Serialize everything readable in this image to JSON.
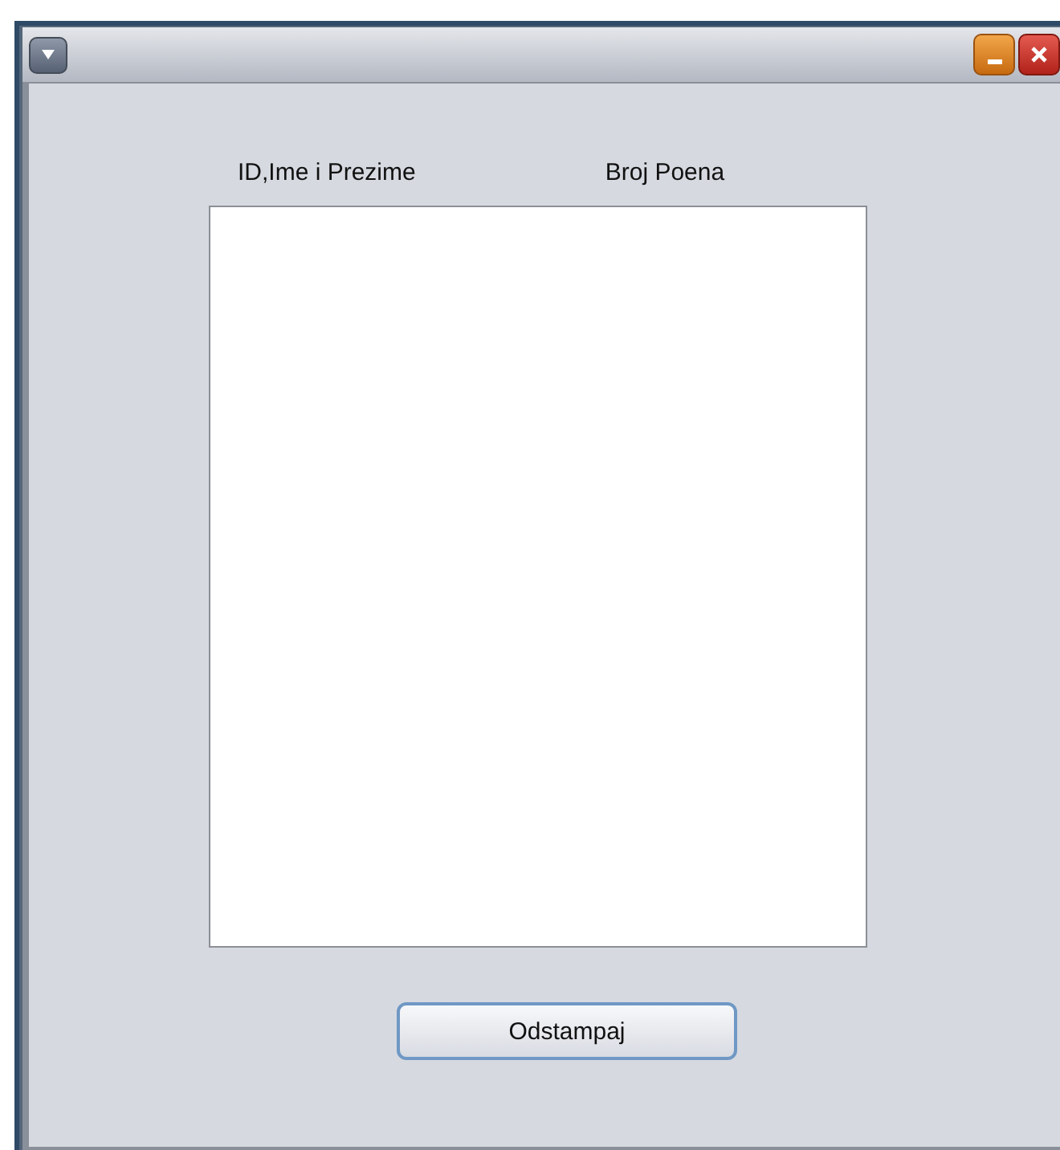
{
  "column_headers": [
    "ID,Ime i Prezime",
    "Broj Poena"
  ],
  "buttons": [
    "Odstampaj"
  ]
}
